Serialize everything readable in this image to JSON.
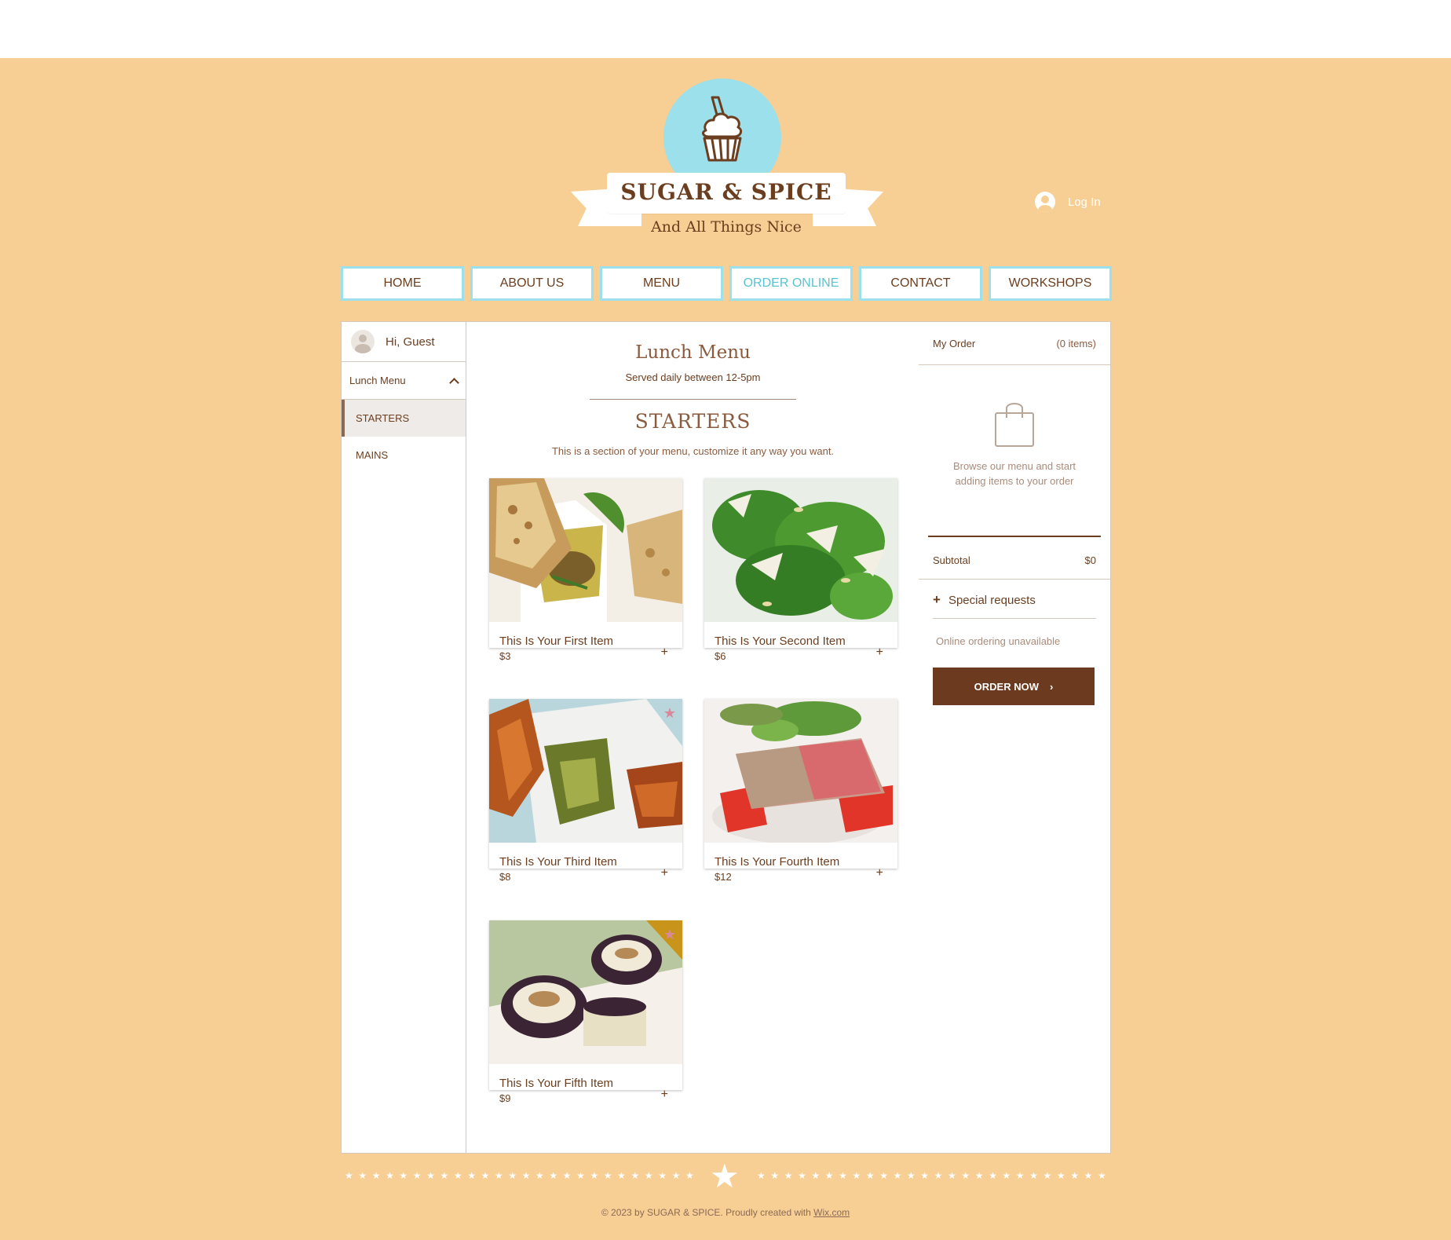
{
  "header": {
    "brand_title": "SUGAR & SPICE",
    "brand_subtitle": "And All Things Nice",
    "login_label": "Log In"
  },
  "nav": [
    {
      "label": "HOME"
    },
    {
      "label": "ABOUT US"
    },
    {
      "label": "MENU"
    },
    {
      "label": "ORDER ONLINE",
      "active": true
    },
    {
      "label": "CONTACT"
    },
    {
      "label": "WORKSHOPS"
    }
  ],
  "sidebar": {
    "greeting": "Hi, Guest",
    "menu_name": "Lunch Menu",
    "sections": [
      {
        "label": "STARTERS",
        "active": true
      },
      {
        "label": "MAINS"
      }
    ]
  },
  "menu": {
    "title": "Lunch Menu",
    "description": "Served daily between 12-5pm",
    "section_title": "STARTERS",
    "section_description": "This is a section of your menu, customize it any way you want.",
    "items": [
      {
        "name": "This Is Your First Item",
        "price": "$3",
        "add": "+"
      },
      {
        "name": "This Is Your Second Item",
        "price": "$6",
        "add": "+"
      },
      {
        "name": "This Is Your Third Item",
        "price": "$8",
        "add": "+",
        "featured": "★"
      },
      {
        "name": "This Is Your Fourth Item",
        "price": "$12",
        "add": "+"
      },
      {
        "name": "This Is Your Fifth Item",
        "price": "$9",
        "add": "+",
        "featured": "★"
      }
    ]
  },
  "order": {
    "title": "My Order",
    "count": "(0 items)",
    "empty_message": "Browse our menu and start adding items to your order",
    "subtotal_label": "Subtotal",
    "subtotal_value": "$0",
    "special_requests_icon": "+",
    "special_requests": "Special requests",
    "status": "Online ordering unavailable",
    "button_label": "ORDER NOW",
    "button_icon": "›"
  },
  "footer": {
    "copyright_text": "© 2023 by SUGAR & SPICE. Proudly created with ",
    "link_text": "Wix.com",
    "star_divider_left": "★★★★★★★★★★★★★★★★★★★★★★★★★★★",
    "star_divider_center": "★",
    "star_divider_right": "★★★★★★★★★★★★★★★★★★★★★★★★★★"
  },
  "colors": {
    "background": "#f7cf95",
    "accent": "#9be0ea",
    "brand_brown": "#6b3a1f",
    "active_nav": "#5bc3cf"
  }
}
